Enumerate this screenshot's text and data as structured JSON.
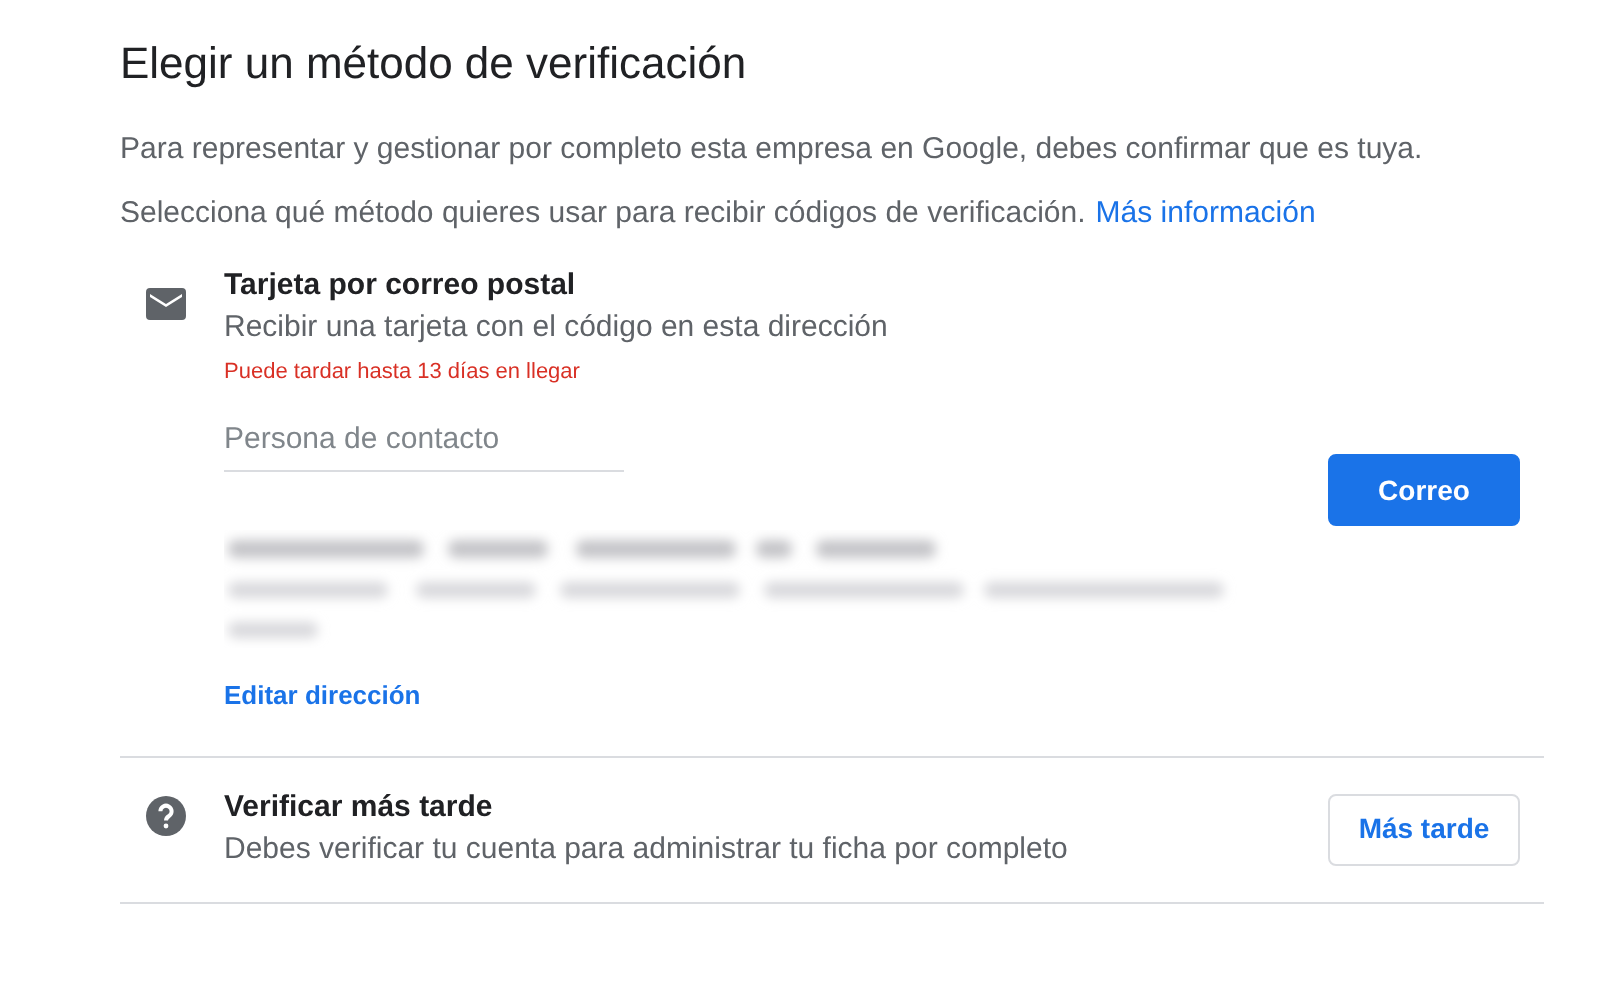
{
  "title": "Elegir un método de verificación",
  "intro": "Para representar y gestionar por completo esta empresa en Google, debes confirmar que es tuya.",
  "instruction": {
    "text": "Selecciona qué método quieres usar para recibir códigos de verificación.",
    "link": "Más información"
  },
  "options": [
    {
      "kind": "postal",
      "title": "Tarjeta por correo postal",
      "description": "Recibir una tarjeta con el código en esta dirección",
      "warning": "Puede tardar hasta 13 días en llegar",
      "contact_field": {
        "placeholder": "Persona de contacto"
      },
      "edit_link": "Editar dirección",
      "button": {
        "label": "Correo",
        "primary": true
      }
    },
    {
      "kind": "later",
      "title": "Verificar más tarde",
      "description": "Debes verificar tu cuenta para administrar tu ficha por completo",
      "button": {
        "label": "Más tarde",
        "primary": false
      }
    }
  ]
}
